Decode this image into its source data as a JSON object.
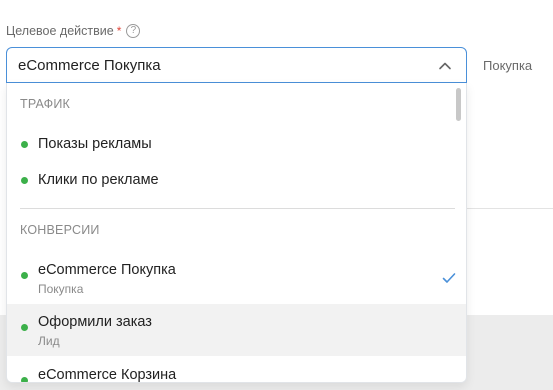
{
  "field": {
    "label": "Целевое действие",
    "required_mark": "*",
    "help_glyph": "?",
    "selected_value": "eCommerce Покупка"
  },
  "side_value": "Покупка",
  "dropdown": {
    "groups": [
      {
        "header": "ТРАФИК",
        "options": [
          {
            "label": "Показы рекламы",
            "sublabel": ""
          },
          {
            "label": "Клики по рекламе",
            "sublabel": ""
          }
        ]
      },
      {
        "header": "КОНВЕРСИИ",
        "options": [
          {
            "label": "eCommerce Покупка",
            "sublabel": "Покупка",
            "selected": true
          },
          {
            "label": "Оформили заказ",
            "sublabel": "Лид",
            "hovered": true
          },
          {
            "label": "eCommerce Корзина",
            "sublabel": ""
          }
        ]
      }
    ]
  },
  "colors": {
    "accent": "#4a90d9",
    "status_dot": "#3cb04a",
    "required": "#e0453a"
  },
  "icons": {
    "help": "question-circle-icon",
    "chevron": "chevron-up-icon",
    "check": "check-icon"
  }
}
